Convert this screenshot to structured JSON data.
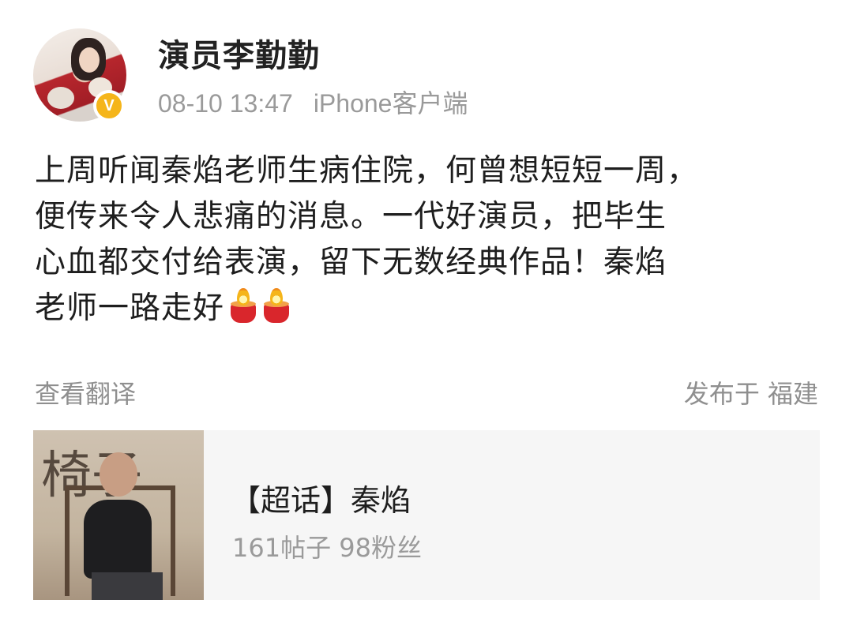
{
  "post": {
    "author_name": "演员李勤勤",
    "time": "08-10 13:47",
    "client": "iPhone客户端",
    "verified_badge": "V",
    "content_lines": [
      "上周听闻秦焰老师生病住院，何曾想短短一周，",
      "便传来令人悲痛的消息。一代好演员，把毕生",
      "心血都交付给表演，留下无数经典作品！秦焰",
      "老师一路走好"
    ],
    "emoji_icons": [
      "candle-icon",
      "candle-icon"
    ],
    "translate_label": "查看翻译",
    "location": "发布于 福建"
  },
  "topic_card": {
    "title": "【超话】秦焰",
    "stats": "161帖子 98粉丝",
    "thumbnail_text": "椅子"
  },
  "colors": {
    "badge": "#f5b51a",
    "meta_text": "#9a9a9a",
    "card_bg": "#f6f6f6"
  }
}
